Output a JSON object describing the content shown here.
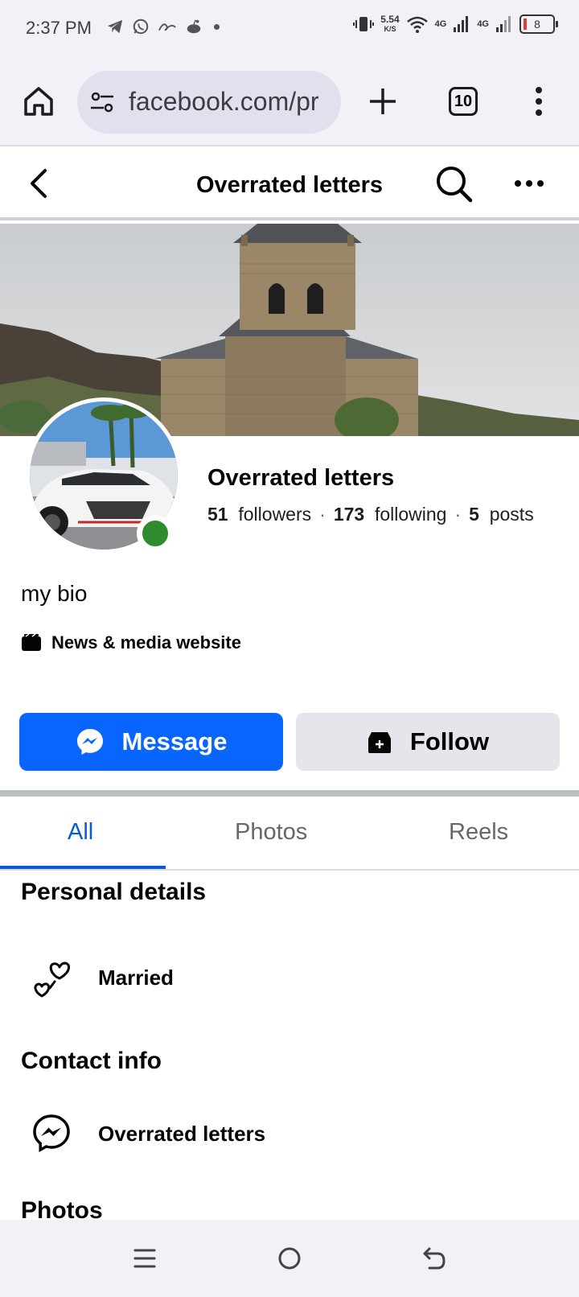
{
  "status_bar": {
    "time": "2:37 PM",
    "net_speed": "5.54",
    "net_speed_unit": "K/S",
    "network_1": "4G",
    "network_2": "4G",
    "battery": "8"
  },
  "browser": {
    "url": "facebook.com/pr",
    "tab_count": "10"
  },
  "header": {
    "title": "Overrated letters"
  },
  "profile": {
    "name": "Overrated letters",
    "followers_count": "51",
    "followers_label": "followers",
    "following_count": "173",
    "following_label": "following",
    "posts_count": "5",
    "posts_label": "posts",
    "separator": "·",
    "bio": "my bio",
    "category": "News & media website"
  },
  "actions": {
    "message_label": "Message",
    "follow_label": "Follow"
  },
  "tabs": [
    {
      "label": "All",
      "active": true
    },
    {
      "label": "Photos",
      "active": false
    },
    {
      "label": "Reels",
      "active": false
    }
  ],
  "personal_details": {
    "title": "Personal details",
    "relationship": "Married"
  },
  "contact_info": {
    "title": "Contact info",
    "messenger": "Overrated letters"
  },
  "photos": {
    "title": "Photos"
  },
  "colors": {
    "accent": "#0866ff",
    "tab_active": "#0a5bd8",
    "online": "#2e8b2e"
  }
}
